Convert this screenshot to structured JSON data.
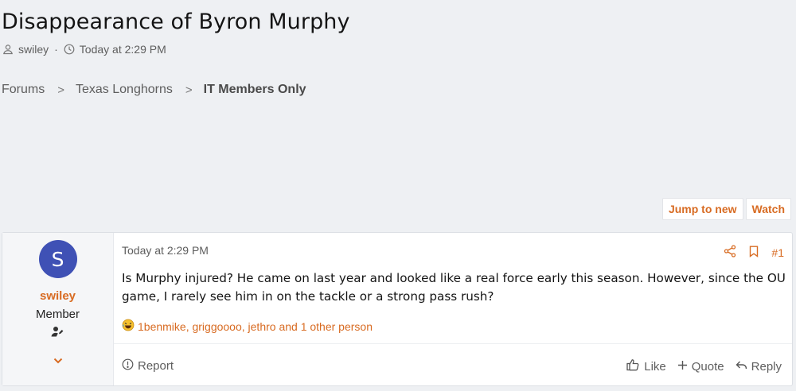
{
  "thread": {
    "title": "Disappearance of Byron Murphy",
    "author": "swiley",
    "separator": "·",
    "date": "Today at 2:29 PM"
  },
  "breadcrumb": {
    "items": [
      {
        "label": "Forums"
      },
      {
        "label": "Texas Longhorns"
      },
      {
        "label": "IT Members Only"
      }
    ],
    "separator": ">"
  },
  "actions": {
    "jump_label": "Jump to new",
    "watch_label": "Watch"
  },
  "post": {
    "user": {
      "initial": "S",
      "name": "swiley",
      "title": "Member",
      "avatar_color": "#3f51b5"
    },
    "date": "Today at 2:29 PM",
    "number": "#1",
    "body": "Is Murphy injured? He came on last year and looked like a real force early this season. However, since the OU game, I rarely see him in on the tackle or a strong pass rush?",
    "reactions_text": "1benmike, griggoooo, jethro and 1 other person",
    "report_label": "Report",
    "like_label": "Like",
    "quote_label": "Quote",
    "reply_label": "Reply"
  },
  "colors": {
    "accent": "#d86b22",
    "background": "#eef0f3"
  }
}
